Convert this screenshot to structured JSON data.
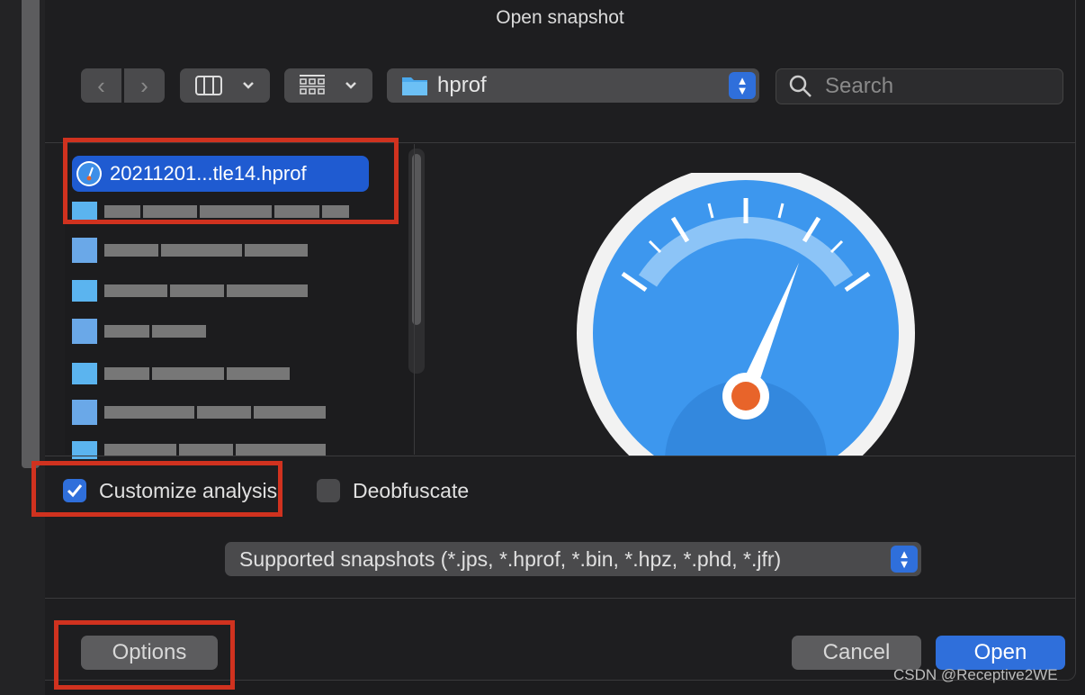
{
  "dialog": {
    "title": "Open snapshot"
  },
  "toolbar": {
    "back_icon": "chevron-left-icon",
    "forward_icon": "chevron-right-icon",
    "view_mode_icon": "columns-icon",
    "group_icon": "grid-icon",
    "location": "hprof",
    "search_placeholder": "Search"
  },
  "files": {
    "selected": "20211201...tle14.hprof"
  },
  "options": {
    "customize_label": "Customize analysis",
    "customize_checked": true,
    "deobfuscate_label": "Deobfuscate",
    "deobfuscate_checked": false
  },
  "filter": {
    "selected": "Supported snapshots (*.jps, *.hprof, *.bin, *.hpz, *.phd, *.jfr)"
  },
  "buttons": {
    "options": "Options",
    "cancel": "Cancel",
    "open": "Open"
  },
  "watermark": "CSDN @Receptive2WE",
  "colors": {
    "accent": "#1f5bd1",
    "highlight": "#d0321f",
    "open_button": "#2f6fdb"
  }
}
